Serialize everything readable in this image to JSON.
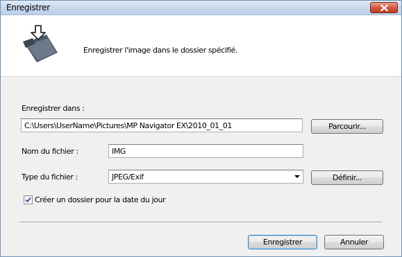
{
  "window": {
    "title": "Enregistrer"
  },
  "header": {
    "message": "Enregistrer l'image dans le dossier spécifié."
  },
  "form": {
    "save_in_label": "Enregistrer dans :",
    "save_in_value": "C:\\Users\\UserName\\Pictures\\MP Navigator EX\\2010_01_01",
    "browse_label": "Parcourir...",
    "filename_label": "Nom du fichier :",
    "filename_value": "IMG",
    "filetype_label": "Type du fichier :",
    "filetype_value": "JPEG/Exif",
    "define_label": "Définir...",
    "create_folder_label": "Créer un dossier pour la date du jour",
    "create_folder_checked": true
  },
  "footer": {
    "save_label": "Enregistrer",
    "cancel_label": "Annuler"
  },
  "icons": {
    "header": "save-to-folder-icon",
    "close": "close-icon",
    "dropdown": "chevron-down-icon",
    "check": "checkmark-icon"
  },
  "colors": {
    "close_button": "#c94a2d",
    "header_bg": "#ffffff",
    "dialog_bg": "#f0f0f0"
  }
}
